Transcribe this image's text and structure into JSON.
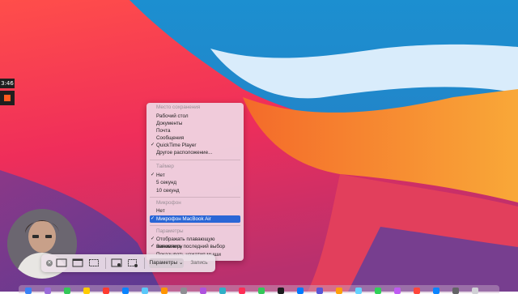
{
  "recording": {
    "timer": "3:46"
  },
  "menu": {
    "sections": [
      {
        "title": "Место сохранения",
        "items": [
          {
            "label": "Рабочий стол",
            "checked": false
          },
          {
            "label": "Документы",
            "checked": false
          },
          {
            "label": "Почта",
            "checked": false
          },
          {
            "label": "Сообщения",
            "checked": false
          },
          {
            "label": "QuickTime Player",
            "checked": true
          },
          {
            "label": "Другое расположение...",
            "checked": false
          }
        ]
      },
      {
        "title": "Таймер",
        "items": [
          {
            "label": "Нет",
            "checked": true
          },
          {
            "label": "5 секунд",
            "checked": false
          },
          {
            "label": "10 секунд",
            "checked": false
          }
        ]
      },
      {
        "title": "Микрофон",
        "items": [
          {
            "label": "Нет",
            "checked": false
          },
          {
            "label": "Микрофон MacBook Air",
            "checked": true,
            "highlighted": true
          }
        ]
      },
      {
        "title": "Параметры",
        "items": [
          {
            "label": "Отображать плавающую миниатюру",
            "checked": true
          },
          {
            "label": "Запомнить последний выбор",
            "checked": true
          },
          {
            "label": "Показывать нажатия мыши",
            "checked": false
          }
        ]
      }
    ]
  },
  "toolbar": {
    "options_label": "Параметры",
    "record_label": "Запись",
    "close_icon": "close-icon",
    "capture_modes": [
      "capture-entire-screen-icon",
      "capture-window-icon",
      "capture-selection-icon",
      "record-entire-screen-icon",
      "record-selection-icon"
    ]
  },
  "colors": {
    "menu_highlight": "#2a66d6",
    "stop_button": "#ff5a1f"
  }
}
